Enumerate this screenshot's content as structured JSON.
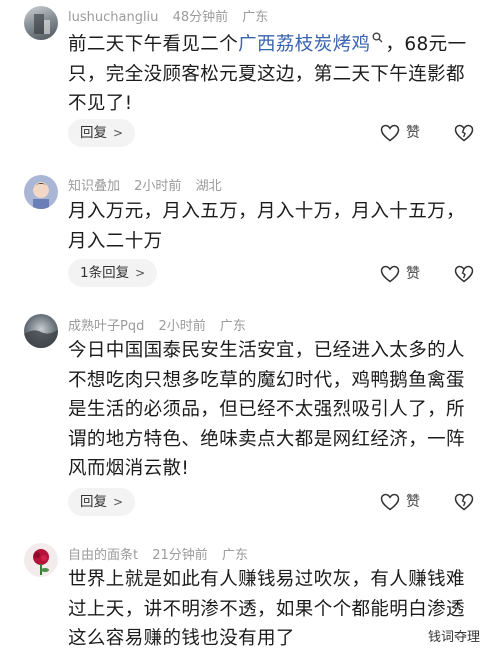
{
  "comments": [
    {
      "username": "lushuchangliu",
      "time": "48分钟前",
      "location": "广东",
      "text_before": "前二天下午看见二个",
      "link_text": "广西荔枝炭烤鸡",
      "text_after": "，68元一只，完全没顾客松元夏这边，第二天下午连影都不见了!",
      "reply_label": "回复",
      "like_label": "赞"
    },
    {
      "username": "知识叠加",
      "time": "2小时前",
      "location": "湖北",
      "text": "月入万元，月入五万，月入十万，月入十五万，月入二十万",
      "reply_label": "1条回复",
      "like_label": "赞"
    },
    {
      "username": "成熟叶子Pqd",
      "time": "2小时前",
      "location": "广东",
      "text": "今日中国国泰民安生活安宜，已经进入太多的人不想吃肉只想多吃草的魔幻时代，鸡鸭鹅鱼禽蛋是生活的必须品，但已经不太强烈吸引人了，所谓的地方特色、绝味卖点大都是网红经济，一阵风而烟消云散!",
      "reply_label": "回复",
      "like_label": "赞"
    },
    {
      "username": "自由的面条t",
      "time": "21分钟前",
      "location": "广东",
      "text": "世界上就是如此有人赚钱易过吹灰，有人赚钱难过上天，讲不明渗不透，如果个个都能明白渗透这么容易赚的钱也没有用了"
    }
  ],
  "watermark": "钱词夺理"
}
